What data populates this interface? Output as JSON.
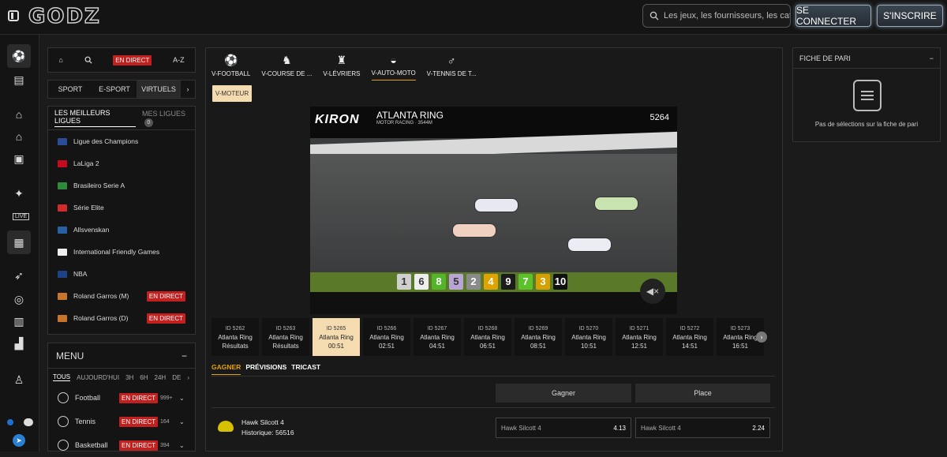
{
  "header": {
    "logo": "GODZ",
    "search_placeholder": "Les jeux, les fournisseurs, les catégories",
    "login": "SE CONNECTER",
    "signup": "S'INSCRIRE"
  },
  "quicknav": {
    "live": "EN DIRECT",
    "az": "A-Z"
  },
  "section_tabs": [
    "SPORT",
    "E-SPORT",
    "VIRTUELS"
  ],
  "leagues": {
    "title": "LES MEILLEURS LIGUES",
    "mine": "MES LIGUES",
    "mine_count": "0",
    "items": [
      {
        "name": "Ligue des Champions",
        "live": ""
      },
      {
        "name": "LaLiga 2",
        "live": ""
      },
      {
        "name": "Brasileiro Serie A",
        "live": ""
      },
      {
        "name": "Série Elite",
        "live": ""
      },
      {
        "name": "Allsvenskan",
        "live": ""
      },
      {
        "name": "International Friendly Games",
        "live": ""
      },
      {
        "name": "NBA",
        "live": ""
      },
      {
        "name": "Roland Garros (M)",
        "live": "EN DIRECT"
      },
      {
        "name": "Roland Garros (D)",
        "live": "EN DIRECT"
      }
    ]
  },
  "menu": {
    "title": "MENU",
    "tabs": [
      "TOUS",
      "AUJOURD'HUI",
      "3H",
      "6H",
      "24H",
      "DE"
    ],
    "sports": [
      {
        "name": "Football",
        "live": "EN DIRECT",
        "count": "999+"
      },
      {
        "name": "Tennis",
        "live": "EN DIRECT",
        "count": "164"
      },
      {
        "name": "Basketball",
        "live": "EN DIRECT",
        "count": "394"
      }
    ]
  },
  "virtual_tabs": [
    "V-FOOTBALL",
    "V-COURSE DE ...",
    "V-LÉVRIERS",
    "V-AUTO-MOTO",
    "V-TENNIS DE T..."
  ],
  "chip": "V-MOTEUR",
  "video": {
    "brand": "KIRON",
    "title": "ATLANTA RING",
    "subtitle": "MOTOR RACING · 3544M",
    "race_id": "5264",
    "positions": [
      "1",
      "6",
      "8",
      "5",
      "2",
      "4",
      "9",
      "7",
      "3",
      "10"
    ]
  },
  "races": [
    {
      "id": "ID 5262",
      "name": "Atlanta Ring",
      "status": "Résultats"
    },
    {
      "id": "ID 5263",
      "name": "Atlanta Ring",
      "status": "Résultats"
    },
    {
      "id": "ID 5265",
      "name": "Atlanta Ring",
      "status": "00:51"
    },
    {
      "id": "ID 5266",
      "name": "Atlanta Ring",
      "status": "02:51"
    },
    {
      "id": "ID 5267",
      "name": "Atlanta Ring",
      "status": "04:51"
    },
    {
      "id": "ID 5268",
      "name": "Atlanta Ring",
      "status": "06:51"
    },
    {
      "id": "ID 5269",
      "name": "Atlanta Ring",
      "status": "08:51"
    },
    {
      "id": "ID 5270",
      "name": "Atlanta Ring",
      "status": "10:51"
    },
    {
      "id": "ID 5271",
      "name": "Atlanta Ring",
      "status": "12:51"
    },
    {
      "id": "ID 5272",
      "name": "Atlanta Ring",
      "status": "14:51"
    },
    {
      "id": "ID 5273",
      "name": "Atlanta Ring",
      "status": "16:51"
    }
  ],
  "bet_tabs": [
    "GAGNER",
    "PRÉVISIONS",
    "TRICAST"
  ],
  "columns": [
    "Gagner",
    "Place"
  ],
  "runner": {
    "name": "Hawk Silcott 4",
    "history": "Historique: 56516",
    "win_label": "Hawk Silcott 4",
    "win_odd": "4.13",
    "place_label": "Hawk Silcott 4",
    "place_odd": "2.24"
  },
  "betslip": {
    "title": "FICHE DE PARI",
    "empty": "Pas de sélections sur la fiche de pari"
  },
  "colors": {
    "accent": "#e5a100",
    "live": "#c21f1f",
    "selected_bg": "#f4dcb0"
  }
}
